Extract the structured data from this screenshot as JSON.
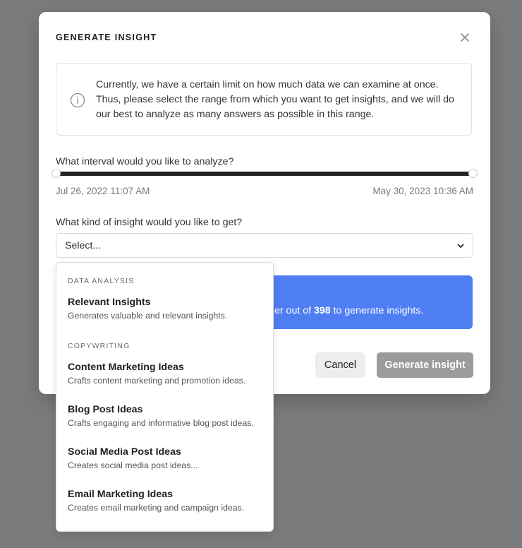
{
  "modal": {
    "title": "GENERATE INSIGHT",
    "close_icon": "close-icon",
    "info_icon": "info-circle-icon",
    "info_text": "Currently, we have a certain limit on how much data we can examine at once. Thus, please select the range from which you want to get insights, and we will do our best to analyze as many answers as possible in this range.",
    "interval_label": "What interval would you like to analyze?",
    "range_start": "Jul 26, 2022 11:07 AM",
    "range_end": "May 30, 2023 10:36 AM",
    "insight_label": "What kind of insight would you like to get?",
    "select_placeholder": "Select...",
    "banner_text_prefix": "er out of ",
    "banner_count": "398",
    "banner_text_suffix": " to generate insights.",
    "cancel_label": "Cancel",
    "generate_label": "Generate insight",
    "accent_color": "#4f7df2"
  },
  "dropdown": {
    "groups": [
      {
        "label": "DATA ANALYSIS",
        "options": [
          {
            "title": "Relevant Insights",
            "desc": "Generates valuable and relevant insights."
          }
        ]
      },
      {
        "label": "COPYWRITING",
        "options": [
          {
            "title": "Content Marketing Ideas",
            "desc": "Crafts content marketing and promotion ideas."
          },
          {
            "title": "Blog Post Ideas",
            "desc": "Crafts engaging and informative blog post ideas."
          },
          {
            "title": "Social Media Post Ideas",
            "desc": "Creates social media post ideas..."
          },
          {
            "title": "Email Marketing Ideas",
            "desc": "Creates email marketing and campaign ideas."
          }
        ]
      }
    ]
  }
}
